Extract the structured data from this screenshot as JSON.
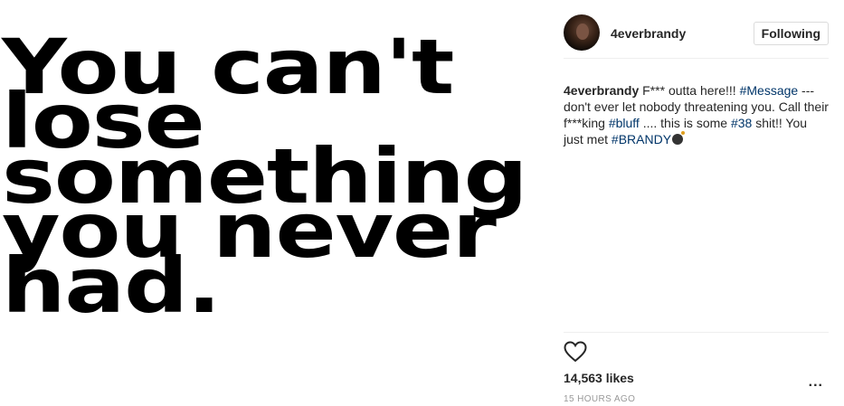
{
  "media": {
    "lines": [
      "You can't",
      "lose",
      "something",
      "you never",
      "had."
    ]
  },
  "header": {
    "username": "4everbrandy",
    "follow_label": "Following",
    "avatar_icon": "profile-avatar"
  },
  "caption": {
    "user": "4everbrandy",
    "t1": " F*** outta here!!! ",
    "tag1": "#Message",
    "t2": " ---don't ever let nobody threatening you. Call their f***king ",
    "tag2": "#bluff",
    "t3": " .... this is some ",
    "tag3": "#38",
    "t4": " shit!! You just met ",
    "tag4": "#BRANDY",
    "emoji_icon": "bomb-icon"
  },
  "actions": {
    "like_icon": "heart-icon",
    "likes": "14,563 likes",
    "timestamp": "15 HOURS AGO",
    "more_label": "..."
  }
}
